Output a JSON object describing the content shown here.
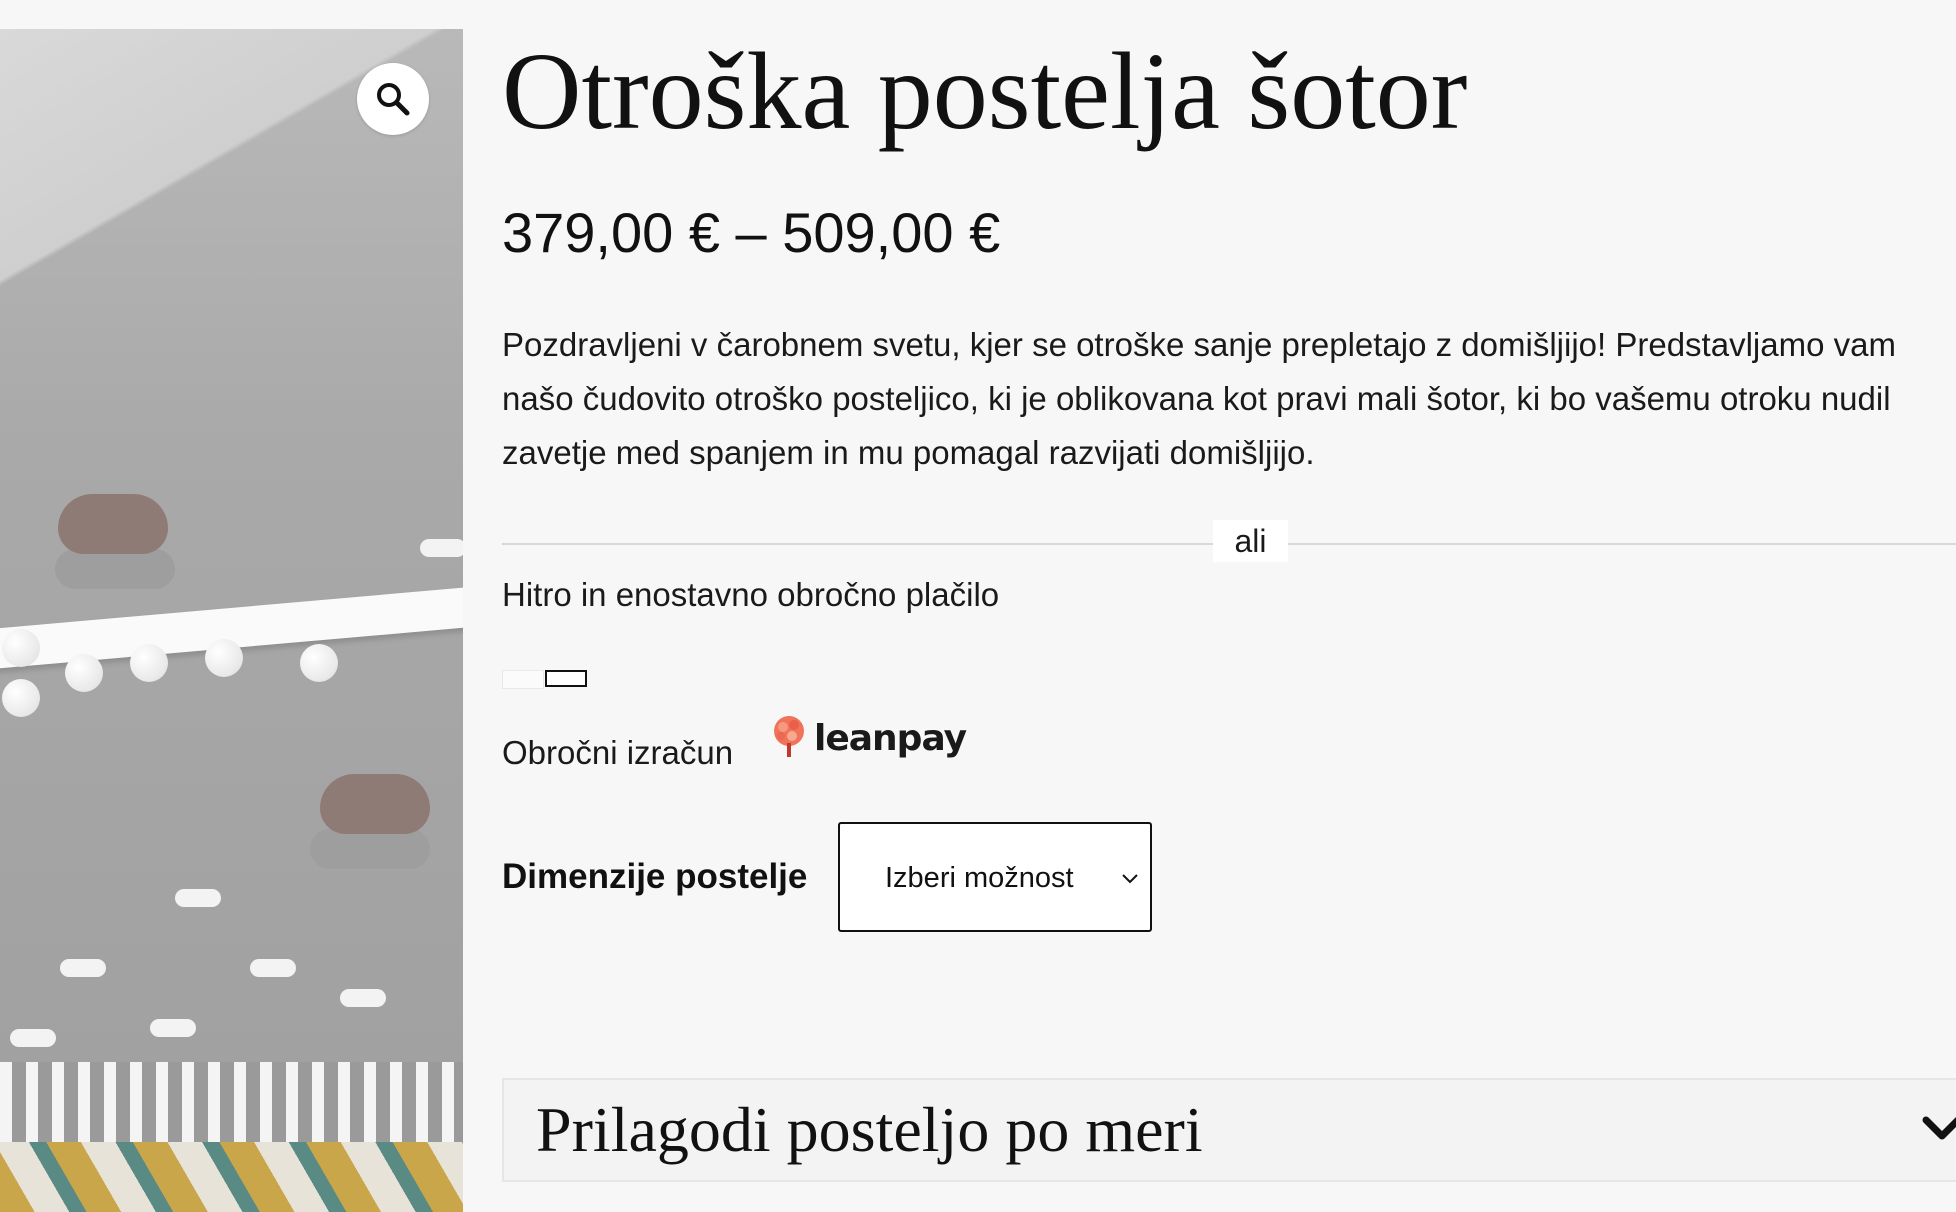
{
  "product": {
    "title": "Otroška postelja šotor",
    "price": "379,00 € – 509,00 €",
    "description": "Pozdravljeni v čarobnem svetu, kjer se otroške sanje prepletajo z domišljijo! Predstavljamo vam našo čudovito otroško posteljico, ki je oblikovana kot pravi mali šotor, ki bo vašemu otroku nudil zavetje med spanjem in mu pomagal razvijati domišljijo.",
    "image_icon": "product-photo"
  },
  "divider": {
    "label": "ali"
  },
  "installments": {
    "title": "Hitro in enostavno obročno plačilo",
    "calc_label": "Obročni izračun",
    "logo_text": "leanpay"
  },
  "variation": {
    "label": "Dimenzije postelje",
    "selected": "Izberi možnost"
  },
  "accordion": {
    "title": "Prilagodi posteljo po meri"
  },
  "icons": {
    "zoom": "magnifier-icon",
    "select_chevron": "chevron-down-icon",
    "accordion_chevron": "chevron-down-icon",
    "leanpay": "leanpay-tree-icon"
  },
  "colors": {
    "background": "#f7f7f7",
    "text": "#111111",
    "leanpay_accent": "#f0735a"
  }
}
